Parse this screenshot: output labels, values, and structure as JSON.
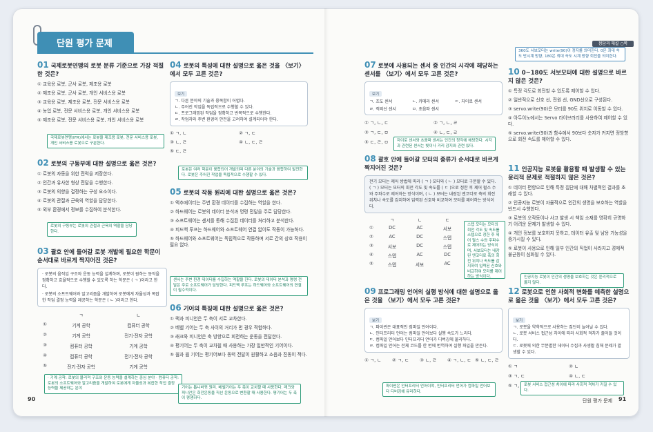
{
  "header": {
    "title": "단원 평가 문제",
    "badge": "정답과 해설 ○쪽"
  },
  "pages": {
    "left_number": "90",
    "right_number": "91",
    "right_footer": "단원 평가 문제"
  },
  "q01": {
    "num": "01",
    "title": "국제로봇연맹의 로봇 분류 기준으로 가장 적절한 것은?",
    "options": [
      "① 교육용 로봇, 군사 로봇, 제조용 로봇",
      "② 제조용 로봇, 군사 로봇, 개인 서비스용 로봇",
      "③ 교육용 로봇, 제조용 로봇, 전문 서비스용 로봇",
      "④ 농업 로봇, 전문 서비스용 로봇, 개인 서비스용 로봇",
      "⑤ 제조용 로봇, 전문 서비스용 로봇, 개인 서비스용 로봇"
    ],
    "note": "국제로봇연맹(IFR)에서는 로봇을 제조용 로봇, 전문 서비스용 로봇, 개인 서비스용 로봇으로 구분한다."
  },
  "q02": {
    "num": "02",
    "title": "로봇의 구동부에 대한 설명으로 옳은 것은?",
    "options": [
      "① 로봇의 자동을 위한 전력을 저장한다.",
      "② 인간과 유사한 형상 전달을 수행한다.",
      "③ 로봇의 의향을 결정하는 구성 요소이다.",
      "④ 로봇의 관절과 근육의 역할을 담당한다.",
      "⑤ 외부 환경에서 정보를 수집하여 분석한다."
    ],
    "note": "로봇의 구동부는 로봇의 관절과 근육의 역할을 담당한다."
  },
  "q03": {
    "num": "03",
    "title": "괄호 안에 들어갈 로봇 개발에 필요한 학문이 순서대로 바르게 짝지어진 것은?",
    "box": [
      "· 로봇의 움직임 구조와 운동 능력을 설계하며, 로봇이 원하는 동작을 정확하고 효율적으로 수행할 수 있도록 하는 학문은 ( ㄱ )이라고 한다.",
      "· 로봇의 소프트웨어와 알고리즘을 개발하여 로봇에게 자율성과 복잡한 작업 결정 능력을 제공하는 학문은 ( ㄴ )이라고 한다."
    ],
    "headers": [
      "ㄱ",
      "ㄴ"
    ],
    "rows": [
      [
        "①",
        "기계 공학",
        "컴퓨터 공학"
      ],
      [
        "②",
        "기계 공학",
        "전기·전자 공학"
      ],
      [
        "③",
        "컴퓨터 공학",
        "기계 공학"
      ],
      [
        "④",
        "컴퓨터 공학",
        "전기·전자 공학"
      ],
      [
        "⑤",
        "전기·전자 공학",
        "기계 공학"
      ]
    ],
    "note": "· 기계 공학: 로봇의 물리적 구조와 운동 능력을 설계하는 중심 분야 · 컴퓨터 공학: 로봇의 소프트웨어와 알고리즘을 개발하여 로봇에게 자율성과 복잡한 작업 결정 능력을 제공하는 분야"
  },
  "q04": {
    "num": "04",
    "title": "로봇의 특성에 대한 설명으로 옳은 것을 〈보기〉에서 모두 고른 것은?",
    "box_tag": "보기",
    "box": [
      "ㄱ. 다른 분야의 기술과 융복합이 어렵다.",
      "ㄴ. 주어진 작업을 독립적으로 수행할 수 있다.",
      "ㄷ. 프로그래밍된 작업을 정확하고 반복적으로 수행한다.",
      "ㄹ. 작업자와 주변 환경의 안전을 고려하여 설계되어야 한다."
    ],
    "options": [
      "① ㄱ, ㄴ",
      "② ㄱ, ㄷ",
      "③ ㄴ, ㄹ",
      "④ ㄴ, ㄷ, ㄹ",
      "⑤ ㄷ, ㄹ"
    ],
    "note": "로봇은 여러 학문이 융합되어 개발되며 다른 분야의 기술과 융합하여 발전한다. 로봇은 주어진 작업을 독립적으로 수행할 수 있다."
  },
  "q05": {
    "num": "05",
    "title": "로봇의 작동 원리에 대한 설명으로 옳은 것은?",
    "options": [
      "① 액추에이터는 주변 환경 데이터를 수집하는 역할을 한다.",
      "② 하드웨어는 로봇의 데이터 분석과 명령 전달을 주로 담당한다.",
      "③ 소프트웨어는 센서를 통해 수집된 데이터를 처리하고 분석한다.",
      "④ 피드백 루프는 하드웨어와 소프트웨어 연결 없이도 작동이 가능하다.",
      "⑤ 하드웨어와 소프트웨어는 독립적으로 작동하며 서로 간의 상호 작용이 필요 없다."
    ],
    "note": "센서는 주변 환경 데이터를 수집하는 역할을 한다. 로봇의 데이터 분석과 명령 전달은 주로 소프트웨어가 담당한다. 피드백 루프는 하드웨어와 소프트웨어의 연결이 필수적이다."
  },
  "q06": {
    "num": "06",
    "title": "기어의 특징에 대한 설명으로 옳은 것은?",
    "options": [
      "① 랙과 피니언은 두 축이 서로 교차한다.",
      "② 베벨 기어는 두 축 사이의 거리가 먼 경우 적합하다.",
      "③ 래크와 피니언은 축 방향으로 회전하는 운동을 전달한다.",
      "④ 평기어는 두 축이 교차될 때 사용하는 가장 일반적인 기어이다.",
      "⑤ 웜과 웜 기어는 평기어보다 동력 전달이 원활하고 소음과 진동이 적다."
    ],
    "note": "기어는 톱니바퀴 원리. 베벨기어는 두 축이 교차할 때 사용한다. 래크와 피니언은 회전운동을 직선 운동으로 변환할 때 사용한다. 평기어는 두 축이 평행하다."
  },
  "q07": {
    "num": "07",
    "title": "로봇에 사용되는 센서 중 인간의 시각에 해당하는 센서를 〈보기〉에서 모두 고른 것은?",
    "box_tag": "보기",
    "box": [
      "ㄱ. 조도 센서",
      "ㄴ. 카메라 센서",
      "ㄷ. 자이로 센서",
      "ㄹ. 적외선 센서",
      "ㅁ. 초음파 센서"
    ],
    "options": [
      "① ㄱ, ㄴ, ㄷ",
      "② ㄱ, ㄴ, ㄹ",
      "③ ㄱ, ㄷ, ㅁ",
      "④ ㄴ, ㄷ, ㄹ",
      "⑤ ㄷ, ㄹ, ㅁ"
    ],
    "note": "자이로 센서와 초음파 센서는 인간의 청각에 해당한다. 시각과 관련된 센서는 빛이나 거리 감지와 관련 있다."
  },
  "q08": {
    "num": "08",
    "title": "괄호 안에 들어갈 모터의 종류가 순서대로 바르게 짝지어진 것은?",
    "box": [
      "전기 모터는 제어 방법에 따라 ( ㄱ ) 모터와 ( ㄴ ) 모터로 구분할 수 있다. ( ㄱ ) 모터는 모터의 회전 각도 및 속도를 ( ㄷ )으로 정한 후 제어 펄스 수와 주파수로 제어하는 방식이며, ( ㄴ ) 모터는 내장된 엔코더로 축의 회전 위치나 속도를 감지하여 입력된 신호와 비교하여 모터를 제어하는 방식이다."
    ],
    "headers": [
      "ㄱ",
      "ㄴ",
      "ㄷ"
    ],
    "rows": [
      [
        "①",
        "DC",
        "AC",
        "서보"
      ],
      [
        "②",
        "AC",
        "DC",
        "스텝"
      ],
      [
        "③",
        "서보",
        "DC",
        "스텝"
      ],
      [
        "④",
        "스텝",
        "AC",
        "DC"
      ],
      [
        "⑤",
        "스텝",
        "서보",
        "AC"
      ]
    ],
    "note": "스텝 모터는 모터의 회전 각도 및 속도를 스텝으로 정한 후 제어 펄스 수와 주파수로 제어하는 방식이며, 서보모터는 내장된 엔코더로 축의 회전 위치나 속도를 감지하여 입력된 신호와 비교하여 모터를 제어하는 방식이다."
  },
  "q09": {
    "num": "09",
    "title": "프로그래밍 언어의 실행 방식에 대한 설명으로 옳은 것을 〈보기〉에서 모두 고른 것은?",
    "box_tag": "보기",
    "box": [
      "ㄱ. 파이썬은 대표적인 컴파일 언어이다.",
      "ㄴ. 인터프리터 언어는 컴파일 언어보다 실행 속도가 느리다.",
      "ㄷ. 컴파일 언어보다 인터프리터 언어가 디버깅에 불리하다.",
      "ㄹ. 컴파일 언어는 전체 코드를 한 번에 번역하여 실행 파일을 만든다."
    ],
    "options": [
      "① ㄱ, ㄴ",
      "② ㄱ, ㄷ",
      "③ ㄴ, ㄹ",
      "④ ㄱ, ㄴ, ㄷ",
      "⑤ ㄴ, ㄷ, ㄹ"
    ],
    "note": "파이썬은 인터프리터 언어이며, 인터프리터 언어가 컴파일 언어보다 디버깅에 유리하다."
  },
  "q10": {
    "num": "10",
    "title": "0~180도 서보모터에 대한 설명으로 바르지 않은 것은?",
    "options": [
      "① 특정 각도로 회전할 수 있도록 제어할 수 있다.",
      "② 일반적으로 신호 선, 전원 선, GND선으로 구성된다.",
      "③ servo.write(90)은 모터를 90도 위치로 이동할 수 있다.",
      "④ 아두이노에서는 Servo 라이브러리를 사용하여 제어할 수 있다.",
      "⑤ servo.write(90)과 함수에서 90보다 숫자가 커지면 정방향으로 회전 속도를 제어할 수 있다."
    ],
    "note": "360도 서보모터는 write(90)이 정지를 의미한다. 0은 최대 속도 반시계 방향, 180은 최대 속도 시계 방향 회전을 의미한다."
  },
  "q11": {
    "num": "11",
    "title": "인공지능 로봇을 활용할 때 발생할 수 있는 윤리적 문제로 적절하지 않은 것은?",
    "options": [
      "① 데이터 편향으로 인해 특정 집단에 대해 차별적인 결과를 초래할 수 있다.",
      "② 인공지능 로봇이 자율적으로 인간의 생명을 보호하는 역할을 반드시 수행한다.",
      "③ 로봇의 오작동이나 사고 발생 시 책임 소재를 명확히 규명하기 어려운 문제가 발생할 수 있다.",
      "④ 개인 정보를 보호하지 못하고, 데이터 유출 및 남용 가능성을 증가시킬 수 있다.",
      "⑤ 로봇이 사용으로 인해 일부 인간의 직업이 사라지고 경제적 불균등이 심화될 수 있다."
    ],
    "note": "인공지능 로봇이 인간의 생명을 보호하는 것은 윤리적으로 옳지 않다."
  },
  "q12": {
    "num": "12",
    "title": "로봇으로 인한 사회적 변화를 예측한 설명으로 옳은 것을 〈보기〉에서 모두 고른 것은?",
    "box_tag": "보기",
    "box": [
      "ㄱ. 로봇을 약학적으로 사용하는 집단이 늘어날 수 있다.",
      "ㄴ. 로봇 서비스 접근성 차이에 따라 사회적 격차가 줄어들 것이다.",
      "ㄷ. 로봇에 의한 무분별한 데이터 수집과 사생활 침해 문제가 발생할 수 있다."
    ],
    "options": [
      "① ㄱ",
      "② ㄴ",
      "③ ㄱ, ㄷ",
      "④ ㄴ, ㄷ",
      "⑤ ㄱ, ㄴ, ㄷ"
    ],
    "note": "로봇 서비스 접근성 차이에 따라 사회적 격차가 커질 수 있다."
  },
  "colors": {
    "accent": "#3f8fb5",
    "note_green": "#2f9c7a",
    "note_blue": "#4d8fbf"
  }
}
